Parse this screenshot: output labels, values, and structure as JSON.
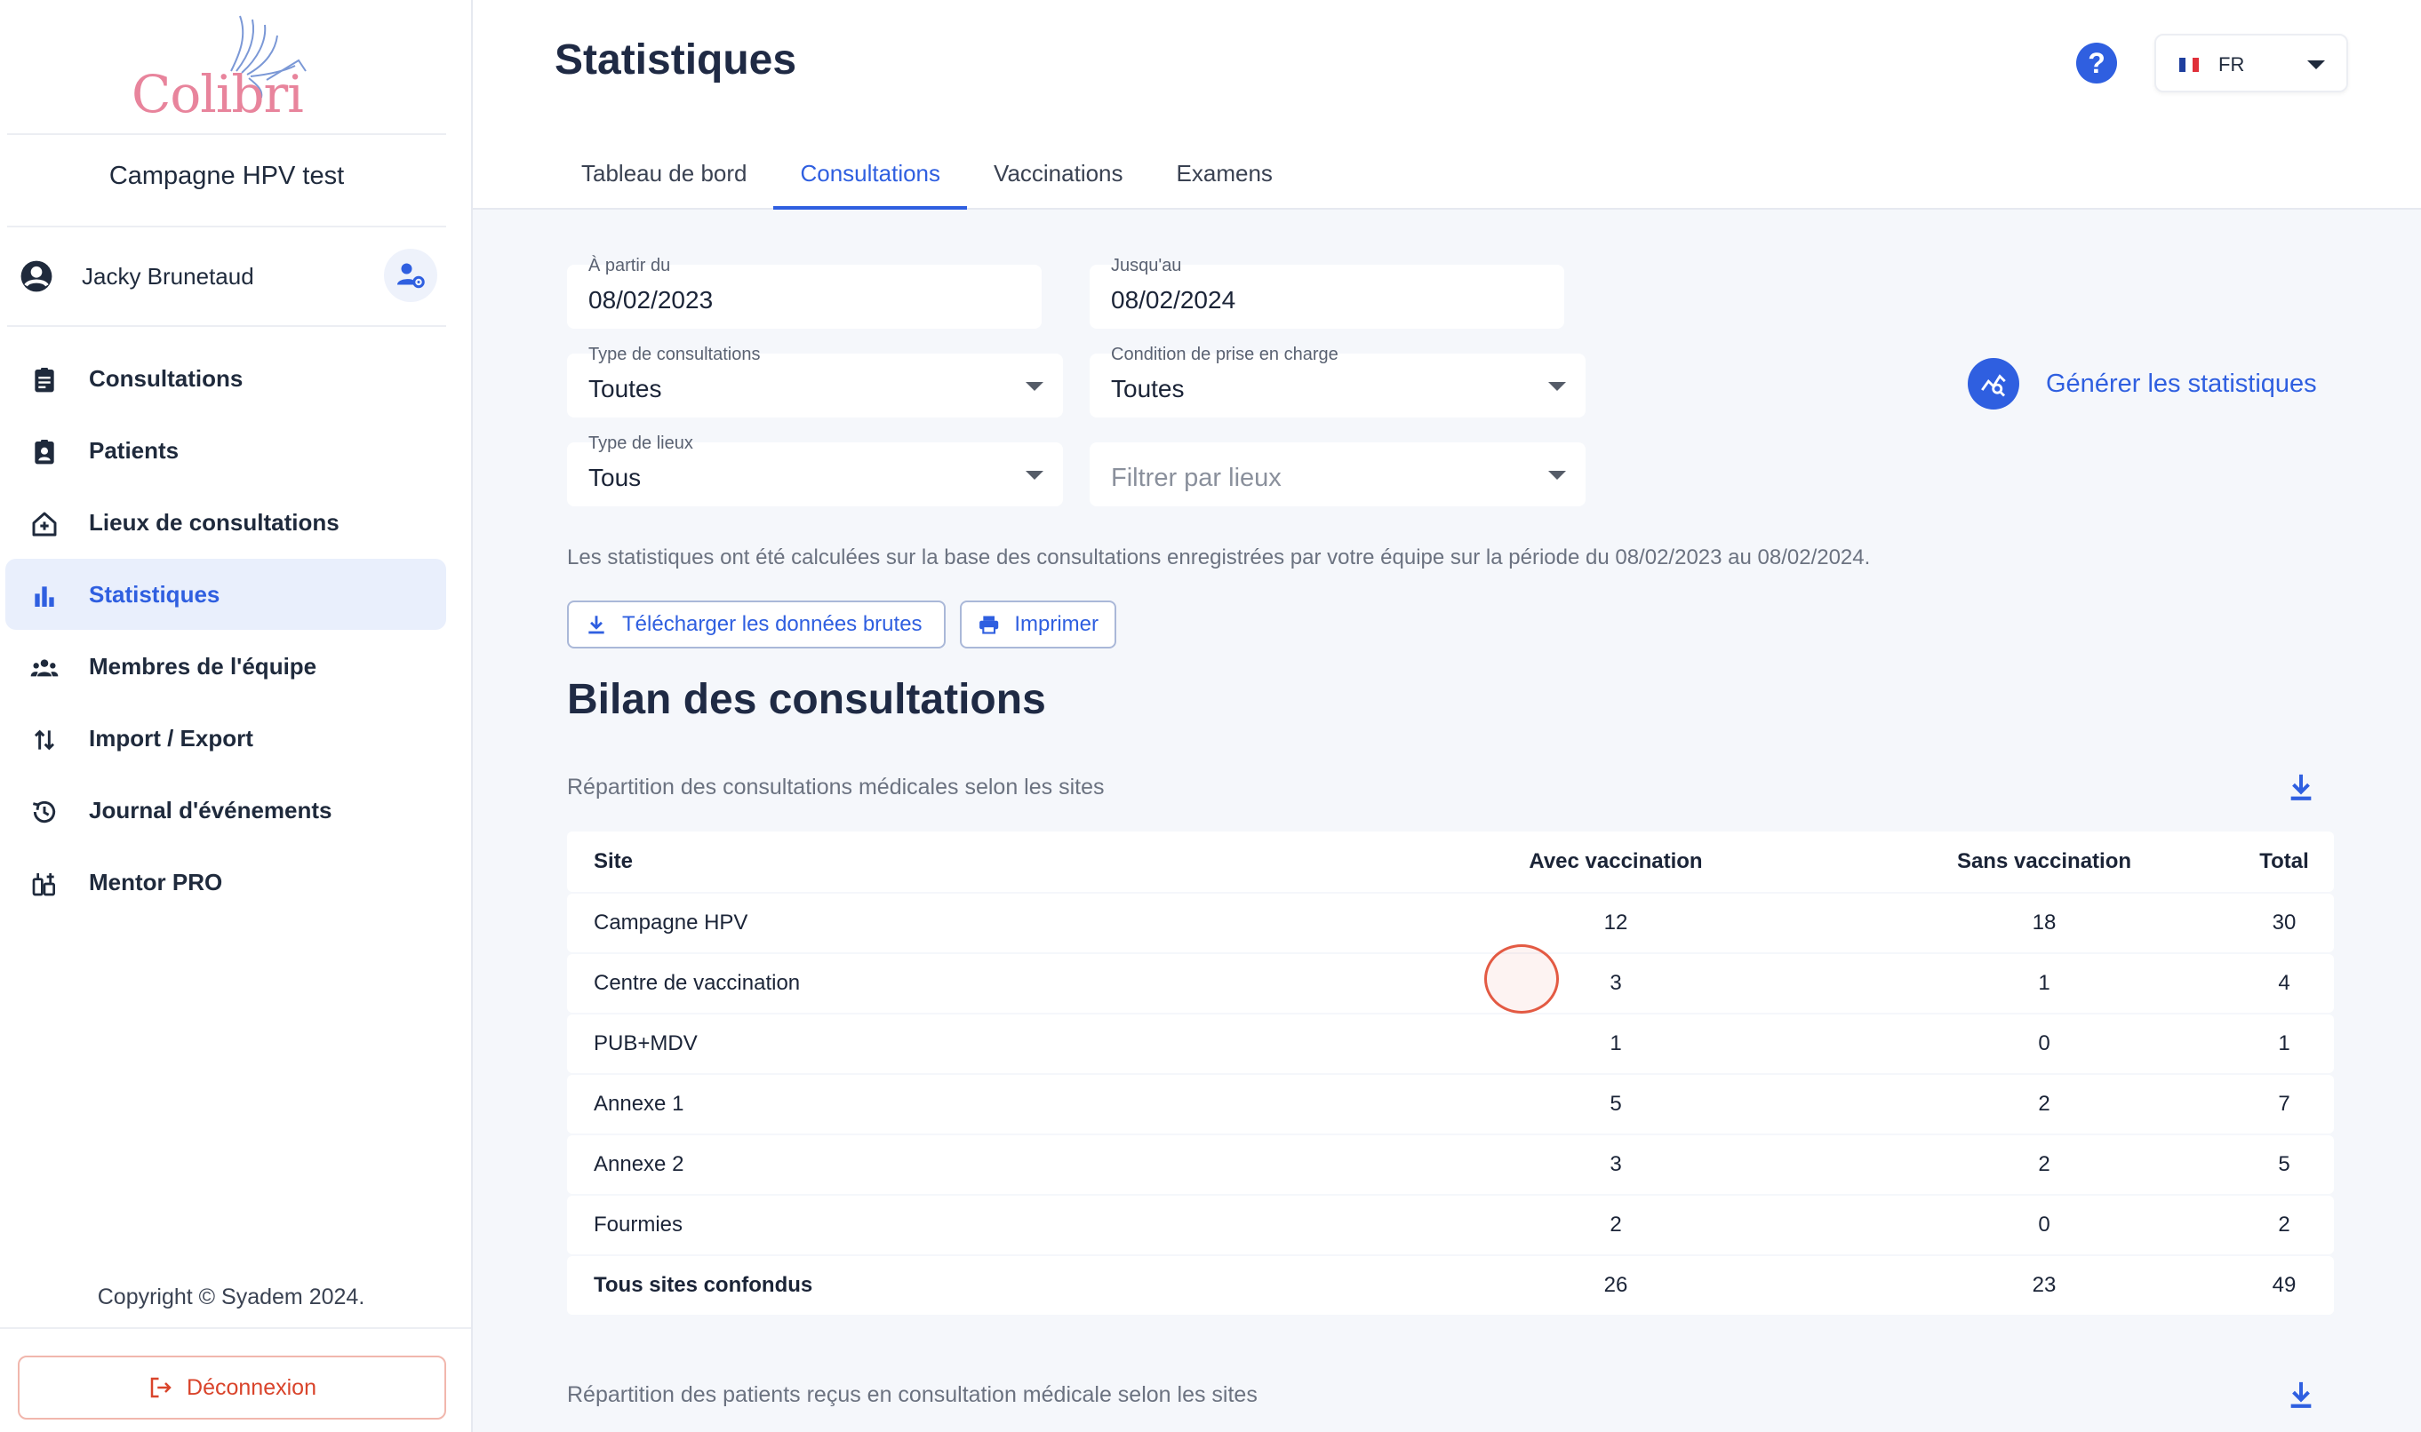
{
  "sidebar": {
    "logo_text": "Colibri",
    "campaign": "Campagne HPV test",
    "user_name": "Jacky Brunetaud",
    "nav": [
      {
        "label": "Consultations",
        "icon": "clipboard-icon"
      },
      {
        "label": "Patients",
        "icon": "patient-card-icon"
      },
      {
        "label": "Lieux de consultations",
        "icon": "house-plus-icon"
      },
      {
        "label": "Statistiques",
        "icon": "bar-chart-icon",
        "active": true
      },
      {
        "label": "Membres de l'équipe",
        "icon": "group-icon"
      },
      {
        "label": "Import / Export",
        "icon": "import-export-icon"
      },
      {
        "label": "Journal d'événements",
        "icon": "history-icon"
      },
      {
        "label": "Mentor PRO",
        "icon": "mentor-icon"
      }
    ],
    "copyright": "Copyright © Syadem 2024.",
    "logout_label": "Déconnexion"
  },
  "header": {
    "title": "Statistiques",
    "help": "?",
    "language": "FR",
    "tabs": [
      {
        "label": "Tableau de bord"
      },
      {
        "label": "Consultations",
        "active": true
      },
      {
        "label": "Vaccinations"
      },
      {
        "label": "Examens"
      }
    ]
  },
  "filters": {
    "from_label": "À partir du",
    "from_value": "08/02/2023",
    "to_label": "Jusqu'au",
    "to_value": "08/02/2024",
    "type_label": "Type de consultations",
    "type_value": "Toutes",
    "condition_label": "Condition de prise en charge",
    "condition_value": "Toutes",
    "lieux_label": "Type de lieux",
    "lieux_value": "Tous",
    "filter_lieux_placeholder": "Filtrer par lieux",
    "generate_label": "Générer les statistiques"
  },
  "info_text": "Les statistiques ont été calculées sur la base des consultations enregistrées par votre équipe sur la période du 08/02/2023 au 08/02/2024.",
  "actions": {
    "download_label": "Télécharger les données brutes",
    "print_label": "Imprimer"
  },
  "section": {
    "title": "Bilan des consultations",
    "subtitle1": "Répartition des consultations médicales selon les sites",
    "subtitle2": "Répartition des patients reçus en consultation médicale selon les sites"
  },
  "table": {
    "columns": [
      "Site",
      "Avec vaccination",
      "Sans vaccination",
      "Total"
    ],
    "rows": [
      [
        "Campagne HPV",
        "12",
        "18",
        "30"
      ],
      [
        "Centre de vaccination",
        "3",
        "1",
        "4"
      ],
      [
        "PUB+MDV",
        "1",
        "0",
        "1"
      ],
      [
        "Annexe 1",
        "5",
        "2",
        "7"
      ],
      [
        "Annexe 2",
        "3",
        "2",
        "5"
      ],
      [
        "Fourmies",
        "2",
        "0",
        "2"
      ]
    ],
    "total": [
      "Tous sites confondus",
      "26",
      "23",
      "49"
    ]
  },
  "colors": {
    "accent": "#2f5fe0",
    "logo_pink": "#e8849c",
    "logout_red": "#d9442b",
    "highlight": "#e35a43"
  }
}
